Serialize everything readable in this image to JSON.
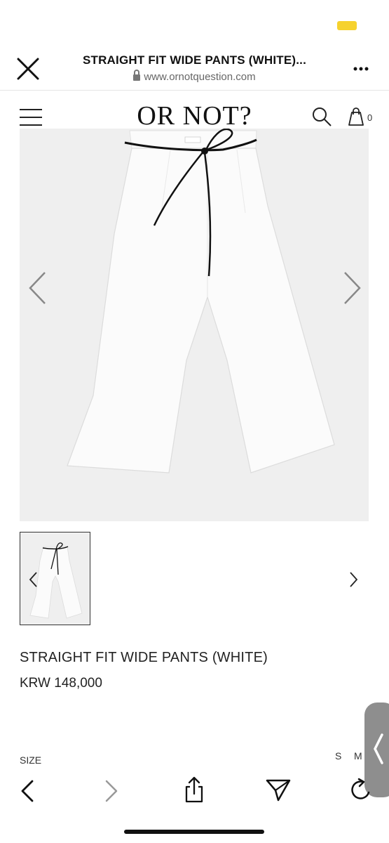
{
  "browser": {
    "title": "STRAIGHT FIT WIDE PANTS (WHITE)...",
    "url": "www.ornotquestion.com"
  },
  "site": {
    "brand": "OR NOT?",
    "cart_count": "0"
  },
  "product": {
    "name": "STRAIGHT FIT WIDE PANTS (WHITE)",
    "price": "KRW 148,000",
    "size_label": "SIZE",
    "sizes": [
      "S",
      "M"
    ]
  },
  "icons": {
    "close": "close-icon",
    "more": "more-icon",
    "menu": "hamburger-icon",
    "search": "search-icon",
    "cart": "shopping-bag-icon",
    "prev": "chevron-left-icon",
    "next": "chevron-right-icon",
    "share": "share-icon",
    "send": "send-icon",
    "reload": "reload-icon"
  },
  "colors": {
    "image_bg": "#efefef",
    "accent_battery": "#f6d22e"
  }
}
